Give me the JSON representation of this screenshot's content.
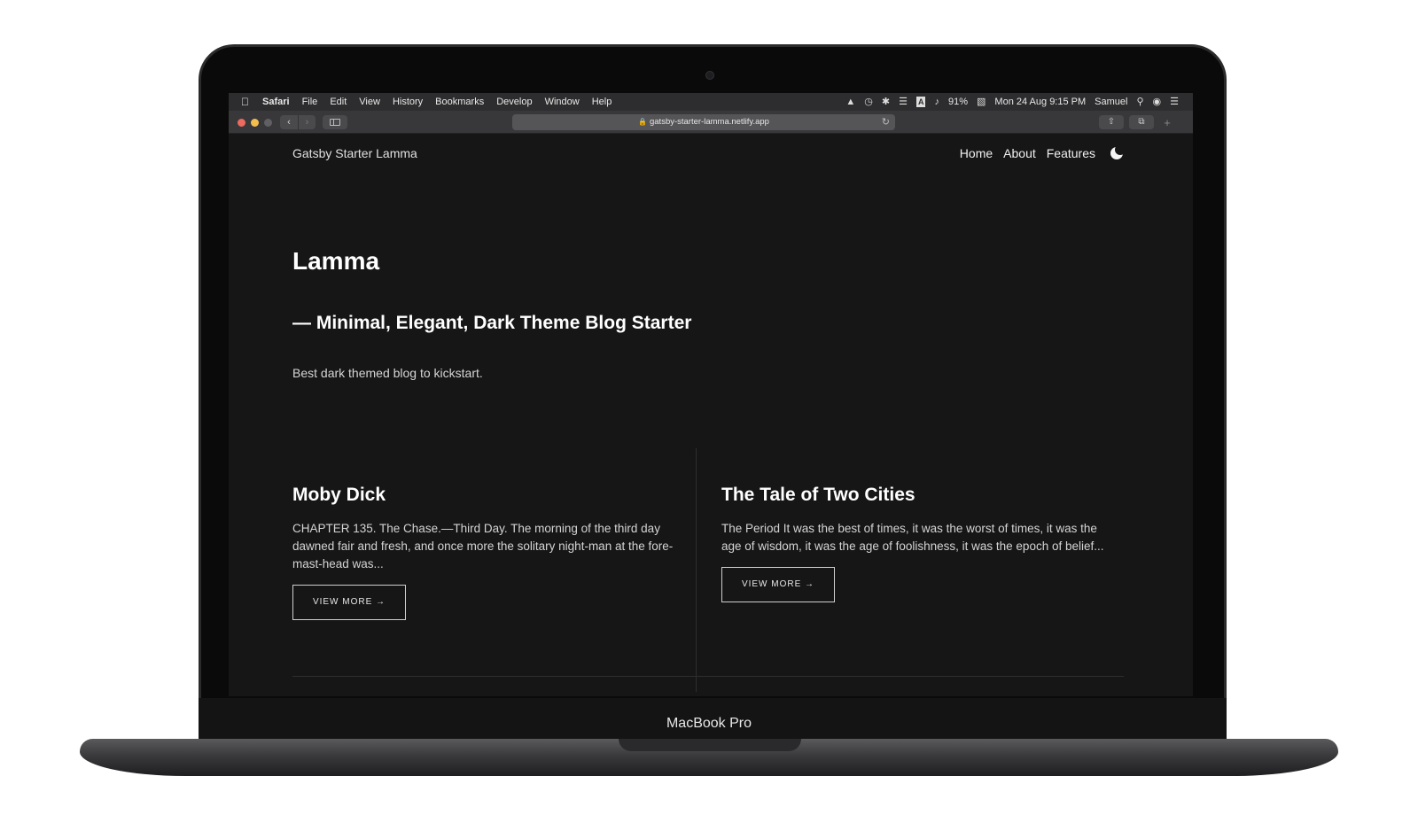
{
  "device": {
    "label": "MacBook Pro"
  },
  "menubar": {
    "apple": "",
    "items": [
      "Safari",
      "File",
      "Edit",
      "View",
      "History",
      "Bookmarks",
      "Develop",
      "Window",
      "Help"
    ],
    "status": {
      "input_source": "A",
      "battery": "91%",
      "datetime": "Mon 24 Aug  9:15 PM",
      "user": "Samuel"
    },
    "icons": [
      "airdrop-icon",
      "time-machine-icon",
      "bluetooth-icon",
      "wifi-icon",
      "input-source-icon",
      "volume-icon",
      "battery-icon",
      "spotlight-icon",
      "siri-icon",
      "notification-center-icon"
    ]
  },
  "browser": {
    "url": "gatsby-starter-lamma.netlify.app"
  },
  "site": {
    "brand": "Gatsby Starter Lamma",
    "nav": [
      "Home",
      "About",
      "Features"
    ],
    "hero": {
      "title": "Lamma",
      "subtitle": "— Minimal, Elegant, Dark Theme Blog Starter",
      "description": "Best dark themed blog to kickstart."
    },
    "posts": [
      {
        "title": "Moby Dick",
        "excerpt": "CHAPTER 135. The Chase.—Third Day. The morning of the third day dawned fair and fresh, and once more the solitary night-man at the fore-mast-head was...",
        "cta": "VIEW MORE →"
      },
      {
        "title": "The Tale of Two Cities",
        "excerpt": "The Period It was the best of times, it was the worst of times, it was the age of wisdom, it was the age of foolishness, it was the epoch of belief...",
        "cta": "VIEW MORE →"
      }
    ]
  }
}
